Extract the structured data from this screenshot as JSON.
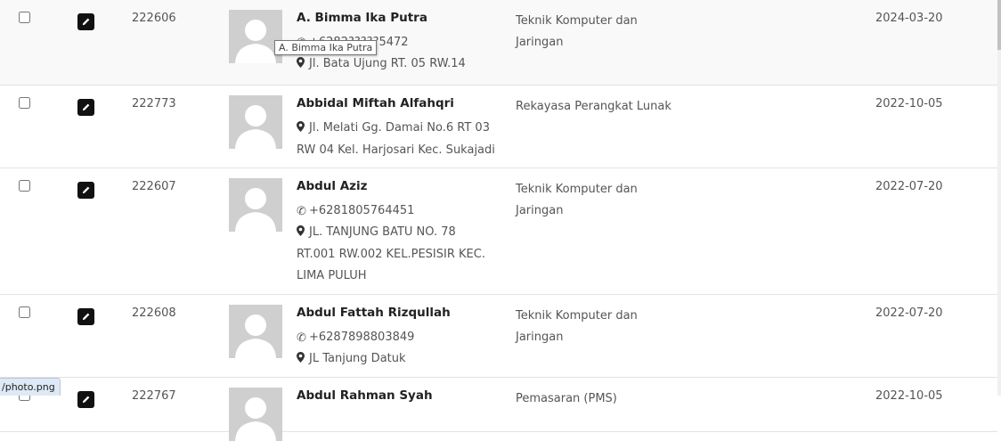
{
  "rows": [
    {
      "nis": "222606",
      "name": "A. Bimma Ika Putra",
      "phone": "+6282?????5472",
      "phone_visible": "5472",
      "address": "Jl. Bata Ujung RT. 05 RW.14",
      "major": "Teknik Komputer dan Jaringan",
      "date": "2024-03-20"
    },
    {
      "nis": "222773",
      "name": "Abbidal Miftah Alfahqri",
      "address": "Jl. Melati Gg. Damai No.6 RT 03 RW 04 Kel. Harjosari Kec. Sukajadi",
      "major": "Rekayasa Perangkat Lunak",
      "date": "2022-10-05"
    },
    {
      "nis": "222607",
      "name": "Abdul Aziz",
      "phone": "+6281805764451",
      "address": "JL. TANJUNG BATU NO. 78 RT.001 RW.002 KEL.PESISIR KEC. LIMA PULUH",
      "major": "Teknik Komputer dan Jaringan",
      "date": "2022-07-20"
    },
    {
      "nis": "222608",
      "name": "Abdul Fattah Rizqullah",
      "phone": "+6287898803849",
      "address": "JL Tanjung Datuk",
      "major": "Teknik Komputer dan Jaringan",
      "date": "2022-07-20"
    },
    {
      "nis": "222767",
      "name": "Abdul Rahman Syah",
      "major": "Pemasaran (PMS)",
      "date": "2022-10-05"
    }
  ],
  "tooltip": "A. Bimma Ika Putra",
  "status_url": "/photo.png",
  "icons": {
    "edit": "pencil-icon",
    "phone": "phone-icon",
    "address": "map-marker-icon"
  }
}
